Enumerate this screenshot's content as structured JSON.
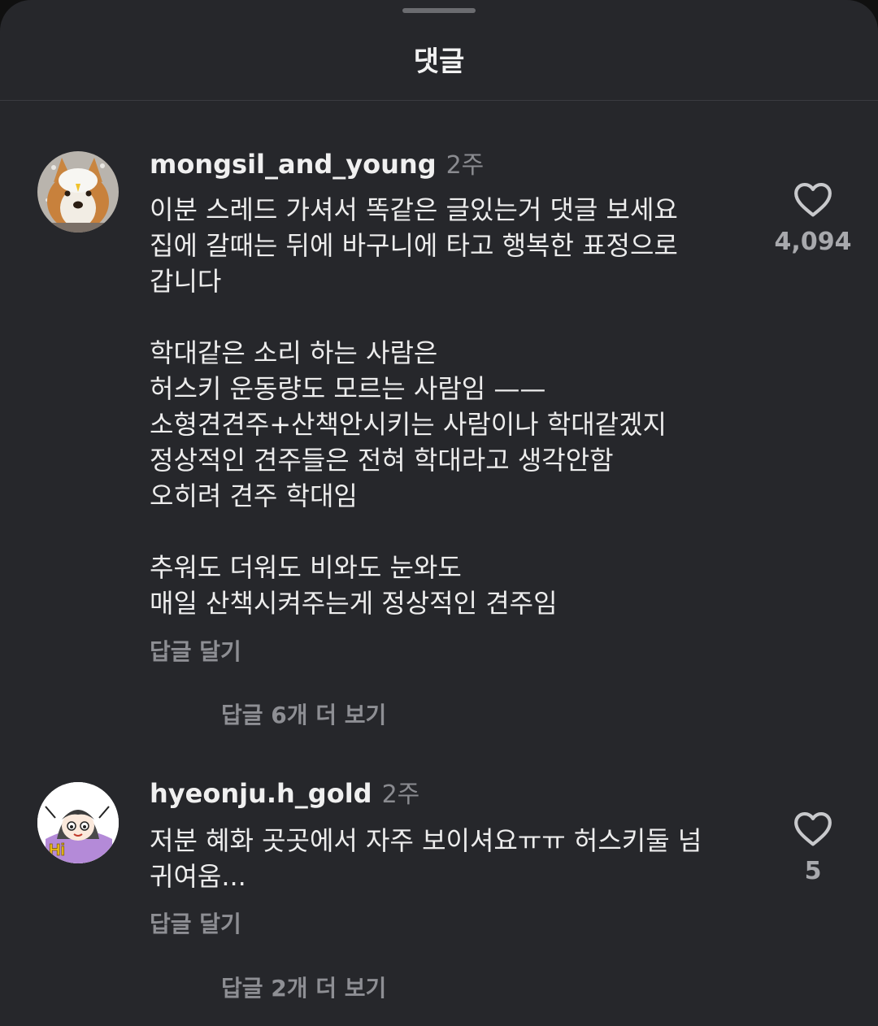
{
  "sheet": {
    "title": "댓글"
  },
  "comments": [
    {
      "username": "mongsil_and_young",
      "time": "2주",
      "text": "이분 스레드 가셔서 똑같은 글있는거 댓글 보세요\n집에 갈때는 뒤에 바구니에 타고 행복한 표정으로\n갑니다\n\n학대같은 소리 하는 사람은\n허스키 운동량도 모르는 사람임 ——\n소형견견주+산책안시키는 사람이나 학대같겠지\n정상적인 견주들은 전혀 학대라고 생각안함\n오히려 견주 학대임\n\n추워도 더워도 비와도 눈와도\n매일 산책시켜주는게 정상적인 견주임",
      "reply_label": "답글 달기",
      "more_replies_label": "답글 6개 더 보기",
      "like_count": "4,094",
      "avatar_icon": "dog-avatar"
    },
    {
      "username": "hyeonju.h_gold",
      "time": "2주",
      "text": "저분 혜화 곳곳에서 자주 보이셔요ㅠㅠ 허스키둘 넘\n귀여움...",
      "reply_label": "답글 달기",
      "more_replies_label": "답글 2개 더 보기",
      "like_count": "5",
      "avatar_icon": "cartoon-girl-avatar"
    }
  ],
  "colors": {
    "background": "#26272b",
    "text": "#ededed",
    "muted": "#8e8f94"
  }
}
